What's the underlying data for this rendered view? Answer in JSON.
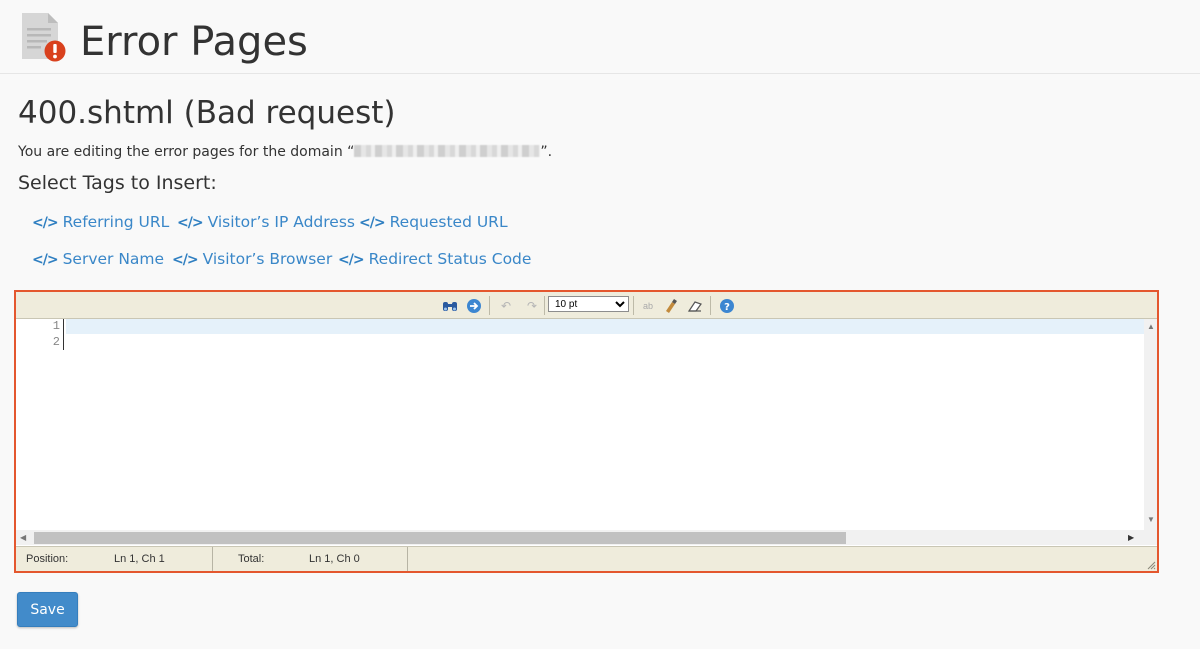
{
  "header": {
    "title": "Error Pages",
    "icon": "error-document-icon"
  },
  "editor_page": {
    "file_title": "400.shtml (Bad request)",
    "domain_prefix": "You are editing the error pages for the domain “",
    "domain_suffix": "”.",
    "tags_heading": "Select Tags to Insert:",
    "tag_icon": "</>",
    "tags": [
      {
        "label": "Referring URL"
      },
      {
        "label": "Visitor’s IP Address"
      },
      {
        "label": "Requested URL"
      },
      {
        "label": "Server Name"
      },
      {
        "label": "Visitor’s Browser"
      },
      {
        "label": "Redirect Status Code"
      }
    ]
  },
  "editor": {
    "toolbar": {
      "buttons": [
        "binoculars-icon",
        "goto-line-icon",
        "undo-icon",
        "redo-icon",
        "spellcheck-icon",
        "highlight-icon",
        "reset-icon",
        "help-icon"
      ],
      "font_size": "10 pt",
      "font_size_options": [
        "10 pt"
      ]
    },
    "line_numbers": [
      "1",
      "2"
    ],
    "status": {
      "position_label": "Position:",
      "position_value": "Ln 1, Ch 1",
      "total_label": "Total:",
      "total_value": "Ln 1, Ch 0"
    }
  },
  "actions": {
    "save_label": "Save"
  },
  "colors": {
    "link": "#3a87c8",
    "accent_border": "#e4572e",
    "primary_button": "#428bca",
    "toolbar_bg": "#efecdc"
  }
}
